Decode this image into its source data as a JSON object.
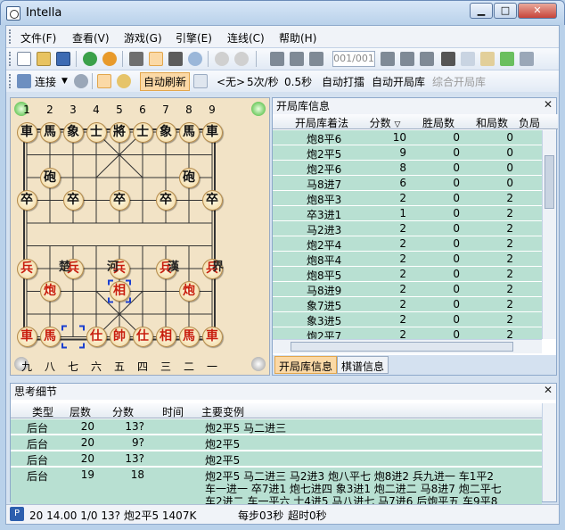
{
  "window": {
    "title": "Intella",
    "min": "▁",
    "max": "□",
    "close": "✕"
  },
  "menu": [
    "文件(F)",
    "查看(V)",
    "游戏(G)",
    "引擎(E)",
    "连线(C)",
    "帮助(H)"
  ],
  "toolbar2": {
    "connect": "连接",
    "auto_refresh": "自动刷新",
    "none": "<无>",
    "rate": "5次/秒",
    "interval": "0.5秒",
    "auto_play": "自动打擂",
    "auto_book": "自动开局库",
    "combined_book": "综合开局库",
    "position": "001/001"
  },
  "board": {
    "top_numbers": [
      "1",
      "2",
      "3",
      "4",
      "5",
      "6",
      "7",
      "8",
      "9"
    ],
    "bottom_numbers": [
      "九",
      "八",
      "七",
      "六",
      "五",
      "四",
      "三",
      "二",
      "一"
    ],
    "river_left": [
      "楚",
      "河"
    ],
    "river_right": [
      "漢",
      "界"
    ],
    "pieces": [
      {
        "t": "車",
        "s": "blk",
        "c": 0,
        "r": 0
      },
      {
        "t": "馬",
        "s": "blk",
        "c": 1,
        "r": 0
      },
      {
        "t": "象",
        "s": "blk",
        "c": 2,
        "r": 0
      },
      {
        "t": "士",
        "s": "blk",
        "c": 3,
        "r": 0
      },
      {
        "t": "將",
        "s": "blk",
        "c": 4,
        "r": 0
      },
      {
        "t": "士",
        "s": "blk",
        "c": 5,
        "r": 0
      },
      {
        "t": "象",
        "s": "blk",
        "c": 6,
        "r": 0
      },
      {
        "t": "馬",
        "s": "blk",
        "c": 7,
        "r": 0
      },
      {
        "t": "車",
        "s": "blk",
        "c": 8,
        "r": 0
      },
      {
        "t": "砲",
        "s": "blk",
        "c": 1,
        "r": 2
      },
      {
        "t": "砲",
        "s": "blk",
        "c": 7,
        "r": 2
      },
      {
        "t": "卒",
        "s": "blk",
        "c": 0,
        "r": 3
      },
      {
        "t": "卒",
        "s": "blk",
        "c": 2,
        "r": 3
      },
      {
        "t": "卒",
        "s": "blk",
        "c": 4,
        "r": 3
      },
      {
        "t": "卒",
        "s": "blk",
        "c": 6,
        "r": 3
      },
      {
        "t": "卒",
        "s": "blk",
        "c": 8,
        "r": 3
      },
      {
        "t": "兵",
        "s": "red",
        "c": 0,
        "r": 6
      },
      {
        "t": "兵",
        "s": "red",
        "c": 2,
        "r": 6
      },
      {
        "t": "兵",
        "s": "red",
        "c": 4,
        "r": 6
      },
      {
        "t": "兵",
        "s": "red",
        "c": 6,
        "r": 6
      },
      {
        "t": "兵",
        "s": "red",
        "c": 8,
        "r": 6
      },
      {
        "t": "炮",
        "s": "red",
        "c": 1,
        "r": 7
      },
      {
        "t": "相",
        "s": "red",
        "c": 4,
        "r": 7
      },
      {
        "t": "炮",
        "s": "red",
        "c": 7,
        "r": 7
      },
      {
        "t": "車",
        "s": "red",
        "c": 0,
        "r": 9
      },
      {
        "t": "馬",
        "s": "red",
        "c": 1,
        "r": 9
      },
      {
        "t": "仕",
        "s": "red",
        "c": 3,
        "r": 9
      },
      {
        "t": "帥",
        "s": "red",
        "c": 4,
        "r": 9
      },
      {
        "t": "仕",
        "s": "red",
        "c": 5,
        "r": 9
      },
      {
        "t": "相",
        "s": "red",
        "c": 6,
        "r": 9
      },
      {
        "t": "馬",
        "s": "red",
        "c": 7,
        "r": 9
      },
      {
        "t": "車",
        "s": "red",
        "c": 8,
        "r": 9
      }
    ]
  },
  "opening_panel": {
    "title": "开局库信息",
    "headers": [
      "开局库着法",
      "分数",
      "胜局数",
      "和局数",
      "负局"
    ],
    "rows": [
      [
        "炮8平6",
        "10",
        "0",
        "0"
      ],
      [
        "炮2平5",
        "9",
        "0",
        "0"
      ],
      [
        "炮2平6",
        "8",
        "0",
        "0"
      ],
      [
        "马8进7",
        "6",
        "0",
        "0"
      ],
      [
        "炮8平3",
        "2",
        "0",
        "2"
      ],
      [
        "卒3进1",
        "1",
        "0",
        "2"
      ],
      [
        "马2进3",
        "2",
        "0",
        "2"
      ],
      [
        "炮2平4",
        "2",
        "0",
        "2"
      ],
      [
        "炮8平4",
        "2",
        "0",
        "2"
      ],
      [
        "炮8平5",
        "2",
        "0",
        "2"
      ],
      [
        "马8进9",
        "2",
        "0",
        "2"
      ],
      [
        "象7进5",
        "2",
        "0",
        "2"
      ],
      [
        "象3进5",
        "2",
        "0",
        "2"
      ],
      [
        "炮2平7",
        "2",
        "0",
        "2"
      ]
    ],
    "tabs": [
      "开局库信息",
      "棋谱信息"
    ]
  },
  "thinking_panel": {
    "title": "思考细节",
    "headers": [
      "类型",
      "层数",
      "分数",
      "时间",
      "主要变例"
    ],
    "rows": [
      {
        "type": "后台",
        "depth": "20",
        "score": "13?",
        "time": "",
        "pv": "炮2平5 马二进三"
      },
      {
        "type": "后台",
        "depth": "20",
        "score": "9?",
        "time": "",
        "pv": "炮2平5"
      },
      {
        "type": "后台",
        "depth": "20",
        "score": "13?",
        "time": "",
        "pv": "炮2平5"
      },
      {
        "type": "后台",
        "depth": "19",
        "score": "18",
        "time": "",
        "pv": "炮2平5 马二进三 马2进3 炮八平七 炮8进2 兵九进一 车1平2",
        "pv2": "车一进一 卒7进1 炮七进四 象3进1 炮二进二 马8进7 炮二平七",
        "pv3": "车2进二 车一平六 士4进5 马八进七 马7进6 后炮平五 车9平8"
      }
    ]
  },
  "status": {
    "p": "P",
    "info": "20 14.00 1/0 13? 炮2平5 1407K",
    "per_step": "每步03秒",
    "timeout": "超时0秒"
  },
  "colors": {
    "row_bg": "#b8e0d2",
    "highlight": "#fbd9a6",
    "red_piece": "#c81d0d"
  }
}
